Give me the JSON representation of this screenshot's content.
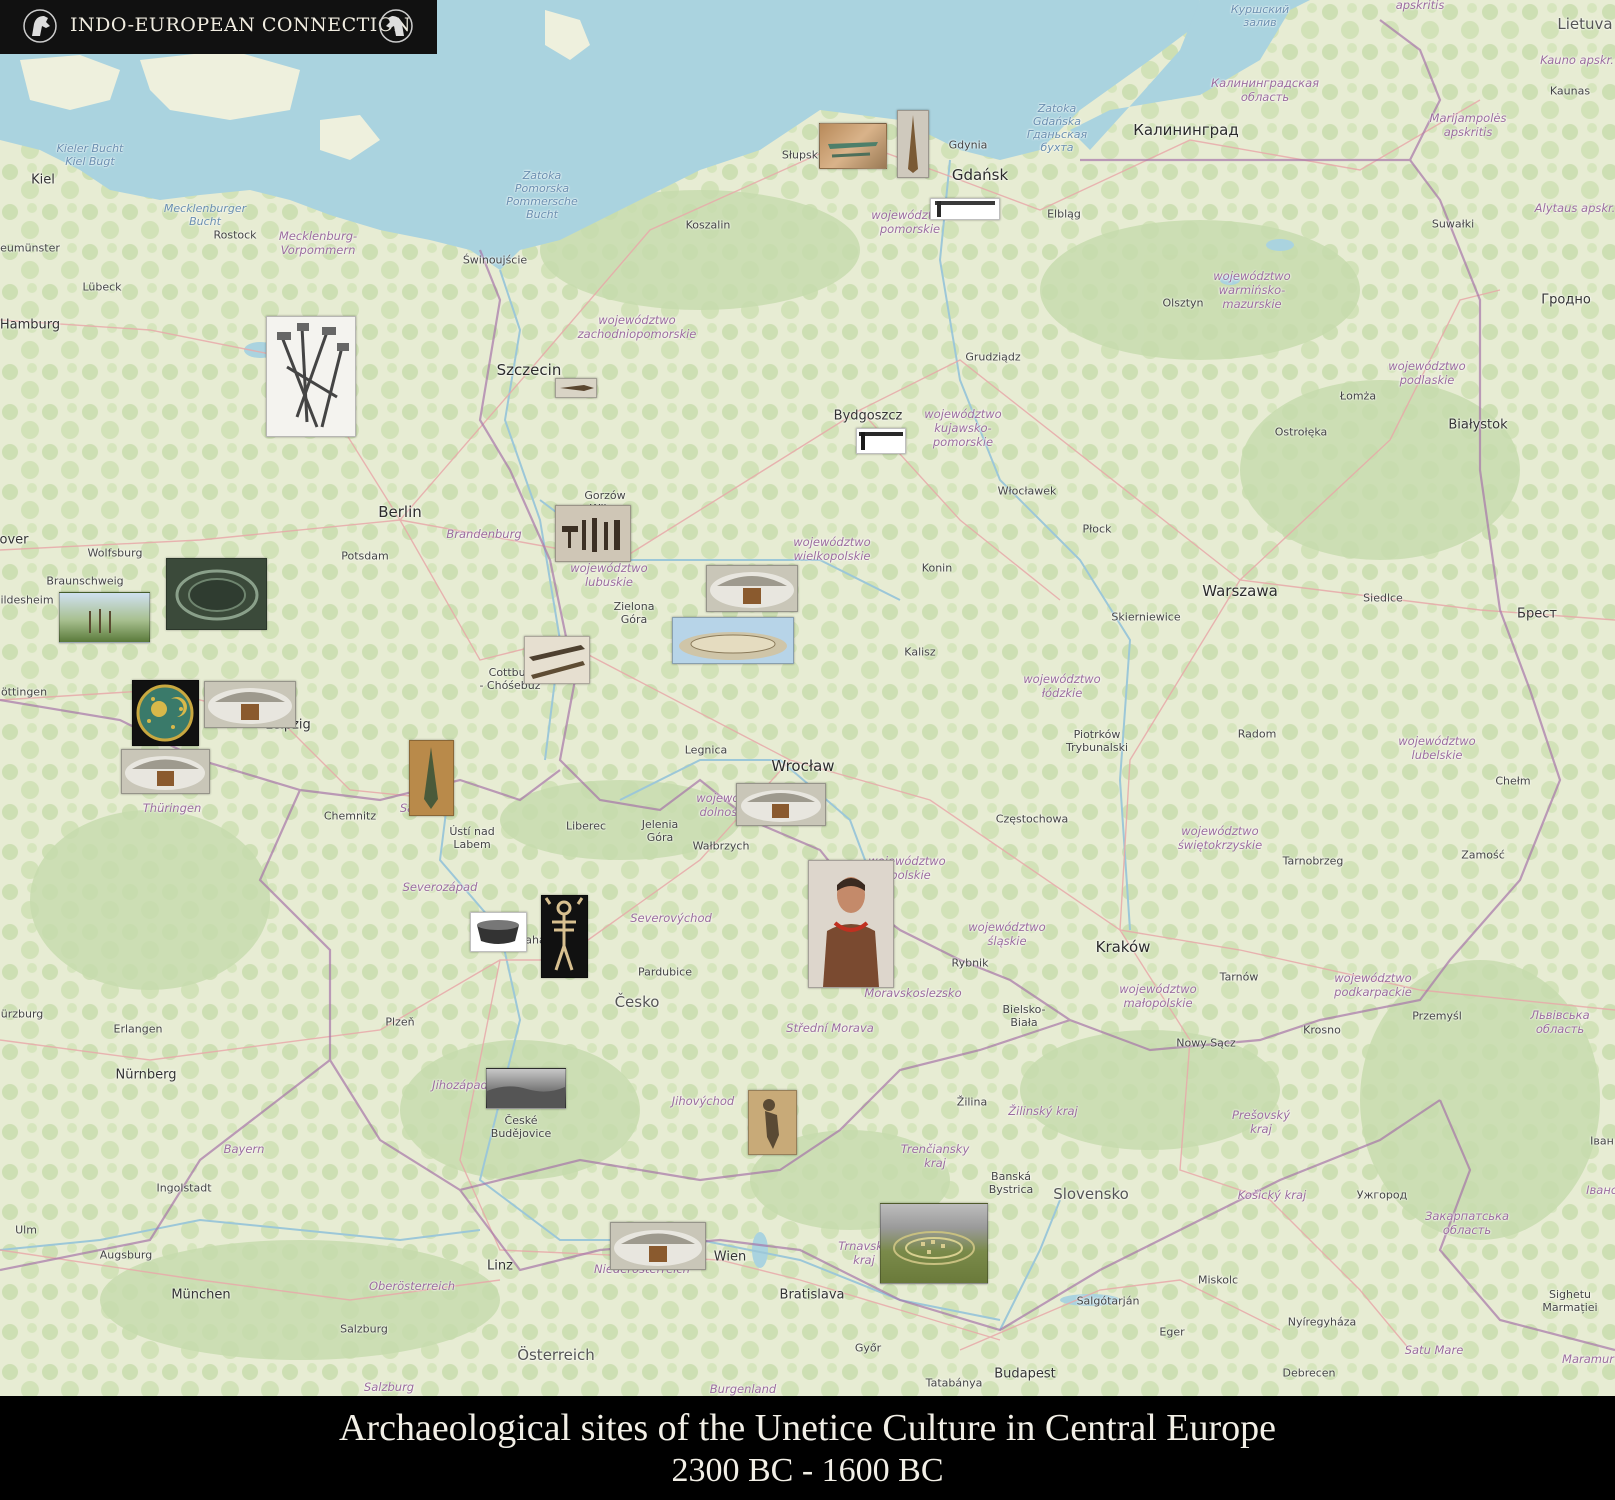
{
  "branding": {
    "name": "INDO-EUROPEAN CONNECTION",
    "icon": "horse-head-icon"
  },
  "caption": {
    "title": "Archaeological sites of the Unetice Culture in Central Europe",
    "date_range": "2300 BC - 1600 BC"
  },
  "colors": {
    "land": "#eef0dd",
    "forest": "#c9dcae",
    "sea": "#aad3df",
    "border": "#a776a9",
    "road": "#e8a0a0",
    "caption_bg": "#000000",
    "caption_text": "#f2efe6"
  },
  "labels": {
    "kiel": "Kiel",
    "kieler_bucht": "Kieler Bucht\nKiel Bugt",
    "mecklenburger_bucht": "Mecklenburger\nBucht",
    "rostock": "Rostock",
    "mecklenburg": "Mecklenburg-\nVorpommern",
    "lubeck": "Lübeck",
    "hamburg": "Hamburg",
    "neumunster": "eumünster",
    "zatoka_pomorska": "Zatoka\nPomorska\nPommersche\nBucht",
    "swinoujscie": "Świnoujście",
    "koszalin": "Koszalin",
    "slupsk": "Słupsk",
    "gdynia": "Gdynia",
    "gdansk": "Gdańsk",
    "elblag": "Elbląg",
    "zatoka_gdanska": "Zatoka\nGdańska\nГданьская\nбухта",
    "kurshsky": "Куршский\nзалив",
    "kaliningrad_obl": "Калининградская\nобласть",
    "kaliningrad": "Калининград",
    "lietuva": "Lietuva",
    "kauno": "Kauno apskr.",
    "kaunas": "Kaunas",
    "marijampoles": "Marijampolės\napskritis",
    "alytaus": "Alytaus apskr.",
    "apskritis_top": "apskritis",
    "pomorskie": "województwo\npomorskie",
    "zachodniopomorskie": "województwo\nzachodniopomorskie",
    "warminsko": "województwo\nwarmińsko-\nmazurskie",
    "olsztyn": "Olsztyn",
    "suwalki": "Suwałki",
    "grodno": "Гродно",
    "podlaskie": "województwo\npodlaskie",
    "lomza": "Łomża",
    "bialystok": "Białystok",
    "ostroleka": "Ostrołęka",
    "grudziadz": "Grudziądz",
    "szczecin": "Szczecin",
    "bydgoszcz": "Bydgoszcz",
    "kujawsko": "województwo\nkujawsko-\npomorskie",
    "wloclawek": "Włocławek",
    "plock": "Płock",
    "gorzow": "Gorzów\nWlkp.",
    "berlin": "Berlin",
    "brandenburg": "Brandenburg",
    "potsdam": "Potsdam",
    "hannover": "over",
    "wolfsburg": "Wolfsburg",
    "braunschweig": "Braunschweig",
    "hildesheim": "ildesheim",
    "lubuskie": "województwo\nlubuskie",
    "zielona_gora": "Zielona\nGóra",
    "wielkopolskie": "województwo\nwielkopolskie",
    "konin": "Konin",
    "warszawa": "Warszawa",
    "skierniewice": "Skierniewice",
    "siedlce": "Siedlce",
    "brest": "Брест",
    "kalisz": "Kalisz",
    "lodzkie": "województwo\nłódzkie",
    "cottbus": "Cottbus\n- Chóśebuz",
    "gottingen": "öttingen",
    "leipzig": "Leipzig",
    "thuringen": "Thüringen",
    "chemnitz": "Chemnitz",
    "sachsen": "Sachsen",
    "legnica": "Legnica",
    "wroclaw": "Wrocław",
    "dolnoslaskie": "województwo\ndolnośląskie",
    "piotrkow": "Piotrków\nTrybunalski",
    "radom": "Radom",
    "lubelskie": "województwo\nlubelskie",
    "chelm": "Chełm",
    "usti": "Ústí nad\nLabem",
    "liberec": "Liberec",
    "jelenia_gora": "Jelenia\nGóra",
    "walbrzych": "Wałbrzych",
    "czestochowa": "Częstochowa",
    "opolskie": "województwo\nopolskie",
    "swietokrzyskie": "województwo\nświętokrzyskie",
    "tarnobrzeg": "Tarnobrzeg",
    "zamosc": "Zamość",
    "severozapad": "Severozápad",
    "severovychod": "Severovýchod",
    "praha": "Praha",
    "pardubice": "Pardubice",
    "cesko": "Česko",
    "slaskie": "województwo\nśląskie",
    "rybnik": "Rybnik",
    "krakow": "Kraków",
    "tarnow": "Tarnów",
    "malopolskie": "województwo\nmałopolskie",
    "podkarpackie": "województwo\npodkarpackie",
    "lviv_obl": "Львівська\nобласть",
    "przemysl": "Przemyśl",
    "krosno": "Krosno",
    "nowy_sacz": "Nowy Sącz",
    "bielsko": "Bielsko-\nBiała",
    "moravskoslezsko": "Moravskoslezsko",
    "stredni_morava": "Střední Morava",
    "wurzburg": "ürzburg",
    "erlangen": "Erlangen",
    "plzen": "Plzeň",
    "nurnberg": "Nürnberg",
    "jihozapad": "Jihozápad",
    "ceske_budejovice": "České\nBudějovice",
    "jihovychod": "Jihovýchod",
    "zilina": "Žilina",
    "zilinsky": "Žilinský kraj",
    "presovsky": "Prešovský\nkraj",
    "ivano": "Іван",
    "bayern": "Bayern",
    "trenciansky": "Trenčiansky\nkraj",
    "banska": "Banská\nBystrica",
    "slovensko": "Slovensko",
    "kosicky": "Košický kraj",
    "uzhgorod": "Ужгород",
    "zakarpatska": "Закарпатська\nобласть",
    "ingolstadt": "Ingolstadt",
    "ulm": "Ulm",
    "augsburg": "Augsburg",
    "linz": "Linz",
    "wien": "Wien",
    "oberosterreich": "Oberösterreich",
    "niederosterreich": "Niederösterreich",
    "trnava": "Trnavský\nkraj",
    "bratislava": "Bratislava",
    "miskolc": "Miskolc",
    "salgotarjan": "Salgótarján",
    "nyiregyhaza": "Nyíregyháza",
    "sighetu": "Sighetu\nMarmației",
    "munchen": "München",
    "salzburg": "Salzburg",
    "osterreich": "Österreich",
    "gyor": "Győr",
    "eger": "Eger",
    "satu_mare": "Satu Mare",
    "maramures": "Maramur",
    "salzburg_land": "Salzburg",
    "burgenland": "Burgenland",
    "tatabanya": "Tatabánya",
    "budapest": "Budapest",
    "debrecen": "Debrecen",
    "ivano2": "Івано"
  },
  "sites": [
    {
      "name": "bronze-artifacts-slupsk",
      "icon": "bronze-artifacts-photo"
    },
    {
      "name": "bronze-dagger-gdynia",
      "icon": "dagger-photo"
    },
    {
      "name": "halberd-gdansk",
      "icon": "halberd-photo"
    },
    {
      "name": "halberd-bundle-mecklenburg",
      "icon": "halberd-bundle-drawing"
    },
    {
      "name": "arrowhead-szczecin",
      "icon": "arrowhead-photo"
    },
    {
      "name": "halberd-bydgoszcz",
      "icon": "halberd-photo"
    },
    {
      "name": "tools-gorzow",
      "icon": "bronze-tools-photo"
    },
    {
      "name": "grave-reconstruction-wielkopolska",
      "icon": "grave-mound-photo"
    },
    {
      "name": "settlement-model-wielkopolska",
      "icon": "settlement-model-photo"
    },
    {
      "name": "circular-enclosure-pommelte",
      "icon": "circular-enclosure-aerial-photo"
    },
    {
      "name": "reconstructed-site-hildesheim",
      "icon": "reconstruction-photo"
    },
    {
      "name": "spearheads-cottbus",
      "icon": "spearhead-photo"
    },
    {
      "name": "nebra-sky-disc",
      "icon": "sky-disc-photo"
    },
    {
      "name": "grave-leipzig",
      "icon": "grave-mound-photo"
    },
    {
      "name": "grave-thuringen",
      "icon": "grave-mound-photo"
    },
    {
      "name": "dagger-sachsen",
      "icon": "dagger-photo"
    },
    {
      "name": "grave-wroclaw",
      "icon": "grave-mound-photo"
    },
    {
      "name": "reconstructed-woman-silesia",
      "icon": "portrait-reconstruction-photo"
    },
    {
      "name": "cup-praha",
      "icon": "cup-photo"
    },
    {
      "name": "skeleton-praha",
      "icon": "skeleton-photo"
    },
    {
      "name": "landscape-ceske-budejovice",
      "icon": "landscape-photo"
    },
    {
      "name": "burial-jihovychod",
      "icon": "burial-photo"
    },
    {
      "name": "grave-wien",
      "icon": "grave-mound-photo"
    },
    {
      "name": "fortified-settlement-trnava",
      "icon": "settlement-model-photo"
    }
  ]
}
